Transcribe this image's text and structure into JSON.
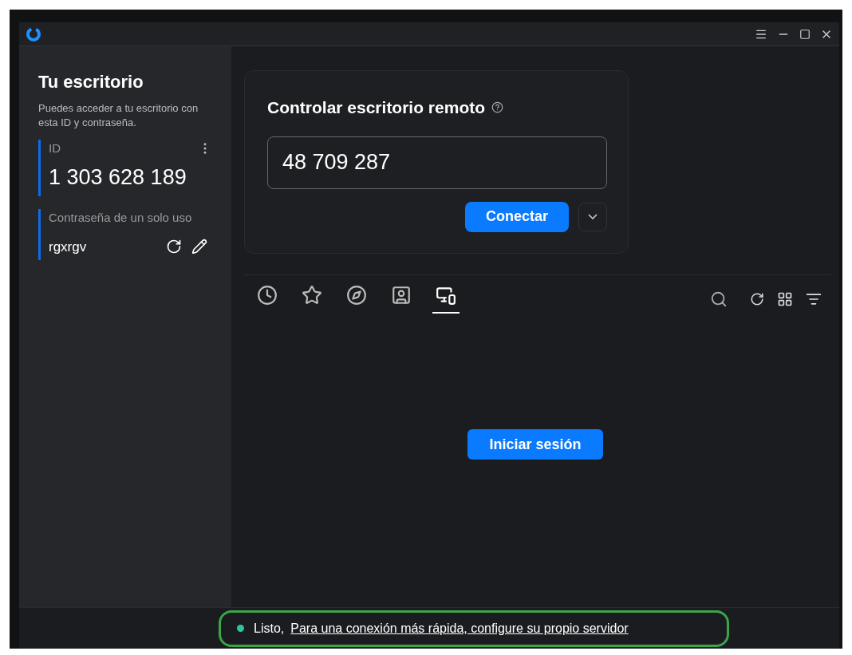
{
  "sidebar": {
    "title": "Tu escritorio",
    "description": "Puedes acceder a tu escritorio con esta ID y contraseña.",
    "id_label": "ID",
    "id_value": "1 303 628 189",
    "password_label": "Contraseña de un solo uso",
    "password_value": "rgxrgv"
  },
  "connect": {
    "title": "Controlar escritorio remoto",
    "value": "48 709 287",
    "button": "Conectar"
  },
  "tabs": [
    {
      "kind": "recent",
      "selected": false
    },
    {
      "kind": "favorites",
      "selected": false
    },
    {
      "kind": "discovered",
      "selected": false
    },
    {
      "kind": "addressbook",
      "selected": false
    },
    {
      "kind": "group",
      "selected": true
    }
  ],
  "login_button": "Iniciar sesión",
  "status_bar": {
    "color": "#2ec4a0",
    "status": "Listo,",
    "link": "Para una conexión más rápida, configure su propio servidor"
  }
}
